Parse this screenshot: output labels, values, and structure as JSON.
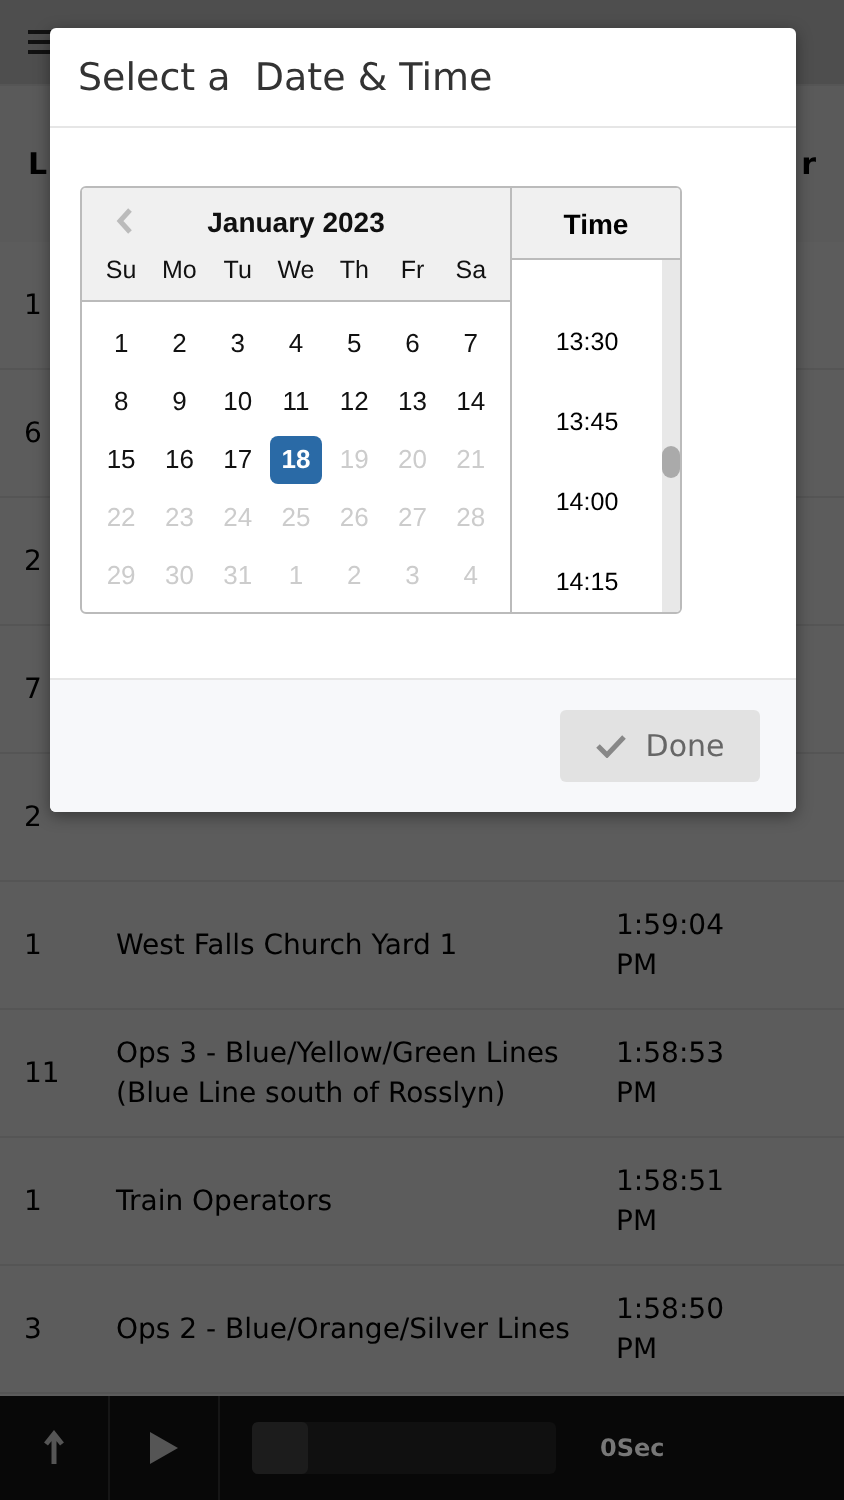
{
  "table": {
    "columns": [
      "L",
      "r"
    ],
    "rows": [
      {
        "count": "1"
      },
      {
        "count": "6"
      },
      {
        "count": "2"
      },
      {
        "count": "7"
      },
      {
        "count": "2"
      },
      {
        "count": "1",
        "name": "West Falls Church Yard 1",
        "time": [
          "1:59:04",
          "PM"
        ]
      },
      {
        "count": "11",
        "name": "Ops 3 - Blue/Yellow/Green Lines (Blue Line south of Rosslyn)",
        "time": [
          "1:58:53",
          "PM"
        ]
      },
      {
        "count": "1",
        "name": "Train Operators",
        "time": [
          "1:58:51",
          "PM"
        ]
      },
      {
        "count": "3",
        "name": "Ops 2 - Blue/Orange/Silver Lines",
        "time": [
          "1:58:50",
          "PM"
        ]
      }
    ]
  },
  "player": {
    "duration": "0Sec"
  },
  "dialog": {
    "title": "Select a  Date & Time",
    "calendar": {
      "month": "January 2023",
      "weekdays": [
        "Su",
        "Mo",
        "Tu",
        "We",
        "Th",
        "Fr",
        "Sa"
      ],
      "days": [
        {
          "label": "1",
          "disabled": false,
          "selected": false
        },
        {
          "label": "2",
          "disabled": false,
          "selected": false
        },
        {
          "label": "3",
          "disabled": false,
          "selected": false
        },
        {
          "label": "4",
          "disabled": false,
          "selected": false
        },
        {
          "label": "5",
          "disabled": false,
          "selected": false
        },
        {
          "label": "6",
          "disabled": false,
          "selected": false
        },
        {
          "label": "7",
          "disabled": false,
          "selected": false
        },
        {
          "label": "8",
          "disabled": false,
          "selected": false
        },
        {
          "label": "9",
          "disabled": false,
          "selected": false
        },
        {
          "label": "10",
          "disabled": false,
          "selected": false
        },
        {
          "label": "11",
          "disabled": false,
          "selected": false
        },
        {
          "label": "12",
          "disabled": false,
          "selected": false
        },
        {
          "label": "13",
          "disabled": false,
          "selected": false
        },
        {
          "label": "14",
          "disabled": false,
          "selected": false
        },
        {
          "label": "15",
          "disabled": false,
          "selected": false
        },
        {
          "label": "16",
          "disabled": false,
          "selected": false
        },
        {
          "label": "17",
          "disabled": false,
          "selected": false
        },
        {
          "label": "18",
          "disabled": false,
          "selected": true
        },
        {
          "label": "19",
          "disabled": true,
          "selected": false
        },
        {
          "label": "20",
          "disabled": true,
          "selected": false
        },
        {
          "label": "21",
          "disabled": true,
          "selected": false
        },
        {
          "label": "22",
          "disabled": true,
          "selected": false
        },
        {
          "label": "23",
          "disabled": true,
          "selected": false
        },
        {
          "label": "24",
          "disabled": true,
          "selected": false
        },
        {
          "label": "25",
          "disabled": true,
          "selected": false
        },
        {
          "label": "26",
          "disabled": true,
          "selected": false
        },
        {
          "label": "27",
          "disabled": true,
          "selected": false
        },
        {
          "label": "28",
          "disabled": true,
          "selected": false
        },
        {
          "label": "29",
          "disabled": true,
          "selected": false
        },
        {
          "label": "30",
          "disabled": true,
          "selected": false
        },
        {
          "label": "31",
          "disabled": true,
          "selected": false
        },
        {
          "label": "1",
          "disabled": true,
          "selected": false
        },
        {
          "label": "2",
          "disabled": true,
          "selected": false
        },
        {
          "label": "3",
          "disabled": true,
          "selected": false
        },
        {
          "label": "4",
          "disabled": true,
          "selected": false
        }
      ]
    },
    "time": {
      "heading": "Time",
      "options": [
        "13:30",
        "13:45",
        "14:00",
        "14:15"
      ]
    },
    "done_button": "Done"
  }
}
